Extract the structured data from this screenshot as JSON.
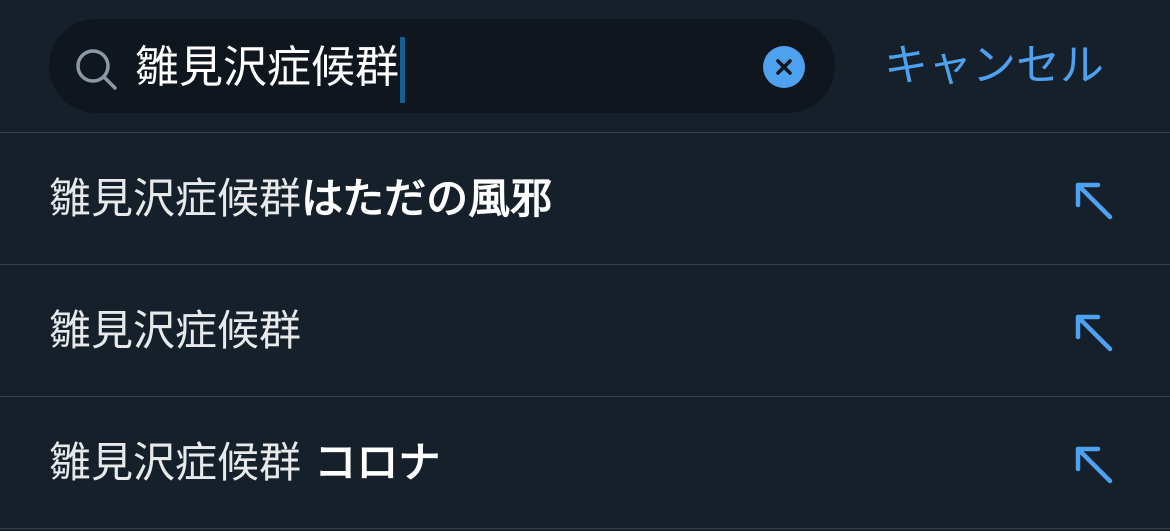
{
  "search": {
    "query": "雛見沢症候群",
    "icon": "search-icon",
    "clear_icon": "close-icon"
  },
  "cancel_label": "キャンセル",
  "suggestions": [
    {
      "prefix": "雛見沢症候群",
      "completion": "はただの風邪",
      "icon": "arrow-up-left-icon"
    },
    {
      "prefix": "雛見沢症候群",
      "completion": "",
      "icon": "arrow-up-left-icon"
    },
    {
      "prefix": "雛見沢症候群 ",
      "completion": "コロナ",
      "icon": "arrow-up-left-icon"
    }
  ],
  "colors": {
    "background": "#15202b",
    "search_field": "#10161d",
    "accent": "#4da1ef",
    "divider": "#38444d"
  }
}
